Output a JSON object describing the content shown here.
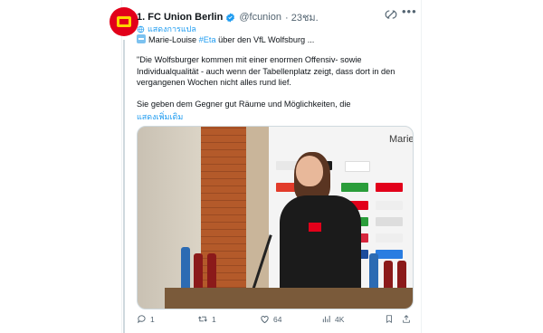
{
  "tweet": {
    "author_name": "1. FC Union Berlin",
    "handle": "@fcunion",
    "time": "· 23ชม.",
    "translate_label": "แสดงการแปล",
    "line1_prefix": "Marie-Louise ",
    "hashtag": "#Eta",
    "line1_suffix": " über den VfL Wolfsburg ...",
    "paragraph1": "\"Die Wolfsburger kommen mit einer enormen Offensiv- sowie Individualqualität - auch wenn der Tabellenplatz zeigt, dass dort in den vergangenen Wochen nicht alles rund lief.",
    "paragraph2": "Sie geben dem Gegner gut Räume und Möglichkeiten, die",
    "show_more": "แสดงเพิ่มเติม",
    "media_board_title": "Marie"
  },
  "actions": {
    "replies": "1",
    "retweets": "1",
    "likes": "64",
    "views": "4K"
  },
  "colors": {
    "accent": "#1d9bf0",
    "brand_red": "#e2001a",
    "text_secondary": "#536471"
  },
  "icons": [
    "verified-badge-icon",
    "grok-icon",
    "more-icon",
    "translate-icon",
    "reply-icon",
    "retweet-icon",
    "like-icon",
    "views-icon",
    "bookmark-icon",
    "share-icon"
  ]
}
